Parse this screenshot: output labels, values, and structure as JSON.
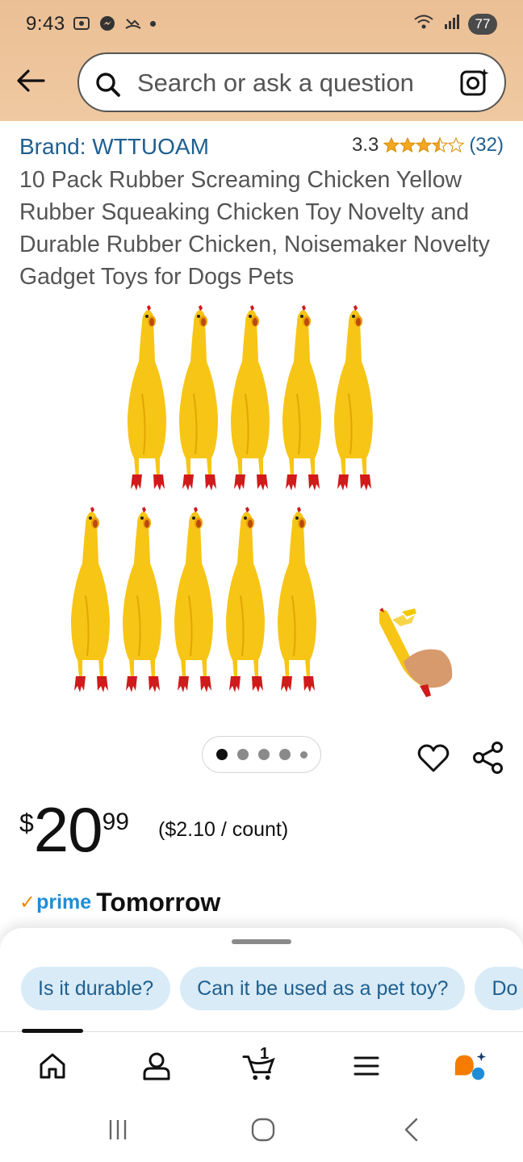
{
  "status_bar": {
    "time": "9:43",
    "battery": "77"
  },
  "search": {
    "placeholder": "Search or ask a question"
  },
  "product": {
    "brand": "Brand: WTTUOAM",
    "rating_value": "3.3",
    "rating_stars": 3.5,
    "rating_count": "(32)",
    "title": "10 Pack Rubber Screaming Chicken Yellow Rubber Squeaking Chicken Toy Novelty and Durable Rubber Chicken, Noisemaker Novelty Gadget Toys for Dogs Pets",
    "image_count": 5,
    "current_image": 1
  },
  "price": {
    "symbol": "$",
    "whole": "20",
    "fraction": "99",
    "unit_price": "($2.10 / count)"
  },
  "delivery": {
    "prime_label": "prime",
    "text": "Tomorrow"
  },
  "questions": [
    {
      "label": "Is it durable?"
    },
    {
      "label": "Can it be used as a pet toy?"
    },
    {
      "label": "Do"
    }
  ],
  "bottom_nav": {
    "cart_count": "1",
    "items": [
      "home-icon",
      "account-icon",
      "cart-icon",
      "menu-icon",
      "rufus-icon"
    ]
  },
  "colors": {
    "header_bg": "#ebbf95",
    "link": "#1f5f8f",
    "star": "#f5a623",
    "prime_blue": "#1f8dd6",
    "chip_bg": "#d9ebf7"
  }
}
